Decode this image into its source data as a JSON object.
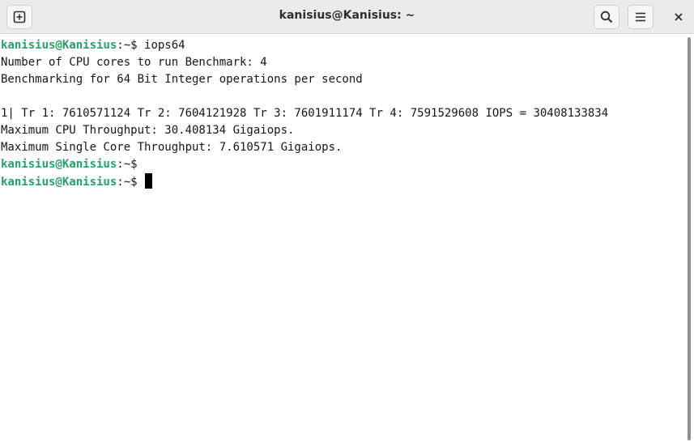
{
  "window": {
    "title": "kanisius@Kanisius: ~"
  },
  "icons": {
    "new_tab": "new-tab-icon",
    "search": "search-icon",
    "menu": "hamburger-menu-icon",
    "close": "close-icon"
  },
  "colors": {
    "prompt": "#26a269",
    "text": "#171421",
    "background": "#ffffff",
    "titlebar": "#ebebeb"
  },
  "terminal": {
    "prompt_user_host": "kanisius@Kanisius",
    "prompt_path": ":~",
    "prompt_symbol": "$",
    "command": " iops64",
    "lines": [
      "Number of CPU cores to run Benchmark: 4",
      "Benchmarking for 64 Bit Integer operations per second",
      "",
      "1| Tr 1: 7610571124 Tr 2: 7604121928 Tr 3: 7601911174 Tr 4: 7591529608 IOPS = 30408133834",
      "Maximum CPU Throughput: 30.408134 Gigaiops.",
      "Maximum Single Core Throughput: 7.610571 Gigaiops."
    ]
  }
}
